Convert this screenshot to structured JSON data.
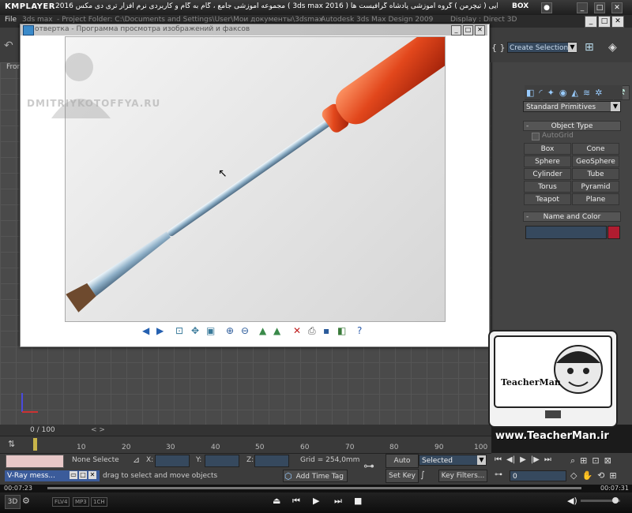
{
  "kmplayer": {
    "logo": "KMPLAYER",
    "caption": "مجموعه آموزشی جامع ، گام به گام و کاربردی نرم افزار تری دی مکس 2016  ( 3ds max 2016 )  مدرس : سعید هدایی ( تیچرمن ) گروه آموزشی پادشاه گرافیست ها",
    "box_label": "BOX",
    "time_elapsed": "00:07:23",
    "time_total": "00:07:31",
    "progress": 0.98,
    "badges": [
      "FLV4",
      "MP3",
      "1CH"
    ]
  },
  "max": {
    "title_left": "3ds max",
    "title_project": "- Project Folder: C:\\Documents and Settings\\User\\Мои документы\\3dsmax",
    "title_app": "- Autodesk 3ds Max Design 2009",
    "title_display": "Display : Direct 3D",
    "file_menu": "File",
    "viewport_label": "Fron",
    "selection_set": "Create Selection Se",
    "primitive_dropdown": "Standard Primitives",
    "object_type_label": "Object Type",
    "autogrid_label": "AutoGrid",
    "primitives": [
      "Box",
      "Cone",
      "Sphere",
      "GeoSphere",
      "Cylinder",
      "Tube",
      "Torus",
      "Pyramid",
      "Teapot",
      "Plane"
    ],
    "name_color_label": "Name and Color",
    "swatch_color": "#b01c30",
    "time_label": "0 / 100",
    "time_arrows": "<     >",
    "ticks": [
      "10",
      "20",
      "30",
      "40",
      "50",
      "60",
      "70",
      "80",
      "90",
      "100"
    ],
    "none_selected": "None Selecte",
    "coord_x": "X:",
    "coord_y": "Y:",
    "coord_z": "Z:",
    "grid_label": "Grid = 254,0mm",
    "auto_key": "Auto Key",
    "set_key": "Set Key",
    "selected_dropdown": "Selected",
    "key_filters": "Key Filters...",
    "add_time_tag": "Add Time Tag",
    "prompt_text": "drag to select and move objects",
    "vray_label": "V-Ray mess...",
    "frame_value": "0"
  },
  "viewer": {
    "title": "отвертка - Программа просмотра изображений и факсов",
    "watermark": "DMITRIYKOTOFFYA.RU"
  },
  "teacher": {
    "logo_text": "TeacherMan",
    "url": "www.TeacherMan.ir"
  }
}
